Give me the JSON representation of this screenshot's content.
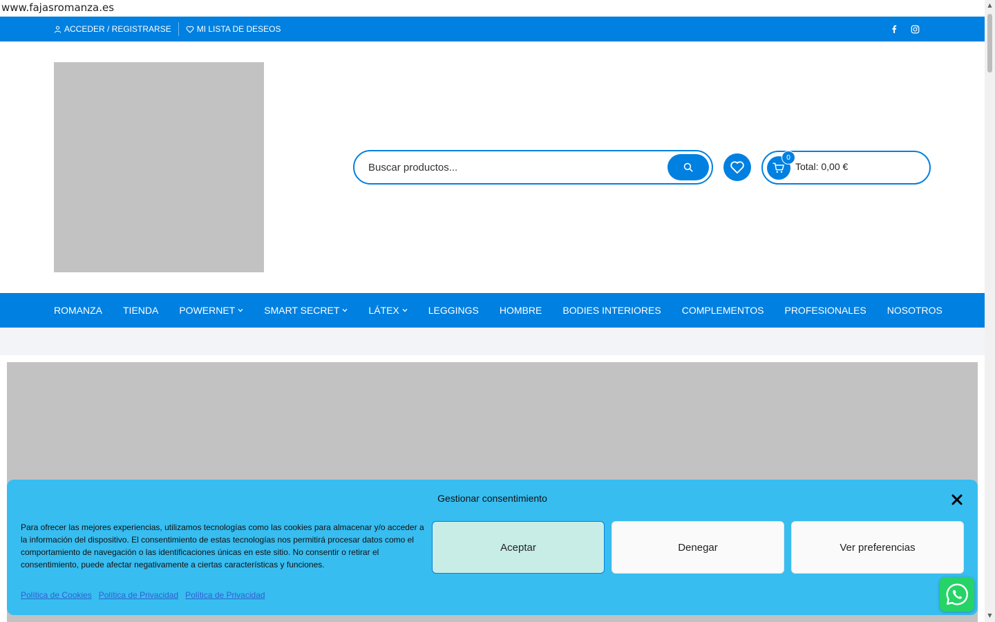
{
  "browser": {
    "url_text": "www.fajasromanza.es"
  },
  "topbar": {
    "account_label": "ACCEDER / REGISTRARSE",
    "wishlist_label": "MI LISTA DE DESEOS",
    "social": [
      {
        "icon": "facebook-icon"
      },
      {
        "icon": "instagram-icon"
      }
    ]
  },
  "header": {
    "search": {
      "placeholder": "Buscar productos..."
    },
    "cart": {
      "count": "0",
      "total": "Total: 0,00 €"
    }
  },
  "nav": {
    "items": [
      {
        "label": "ROMANZA",
        "has_submenu": false
      },
      {
        "label": "TIENDA",
        "has_submenu": false
      },
      {
        "label": "POWERNET",
        "has_submenu": true
      },
      {
        "label": "SMART SECRET",
        "has_submenu": true
      },
      {
        "label": "LÁTEX",
        "has_submenu": true
      },
      {
        "label": "LEGGINGS",
        "has_submenu": false
      },
      {
        "label": "HOMBRE",
        "has_submenu": false
      },
      {
        "label": "BODIES INTERIORES",
        "has_submenu": false
      },
      {
        "label": "COMPLEMENTOS",
        "has_submenu": false
      },
      {
        "label": "PROFESIONALES",
        "has_submenu": false
      },
      {
        "label": "NOSOTROS",
        "has_submenu": false
      }
    ]
  },
  "consent": {
    "title": "Gestionar consentimiento",
    "text": "Para ofrecer las mejores experiencias, utilizamos tecnologías como las cookies para almacenar y/o acceder a la información del dispositivo. El consentimiento de estas tecnologías nos permitirá procesar datos como el comportamiento de navegación o las identificaciones únicas en este sitio. No consentir o retirar el consentimiento, puede afectar negativamente a ciertas características y funciones.",
    "accept_label": "Aceptar",
    "deny_label": "Denegar",
    "prefs_label": "Ver preferencias",
    "links": [
      "Política de Cookies",
      "Política de Privacidad",
      "Política de Privacidad"
    ]
  },
  "colors": {
    "brand_blue": "#0080e0",
    "consent_bg": "#38bdf0",
    "accept_bg": "#c8ede6",
    "whatsapp_green": "#25d366",
    "placeholder_gray": "#c2c2c2"
  }
}
